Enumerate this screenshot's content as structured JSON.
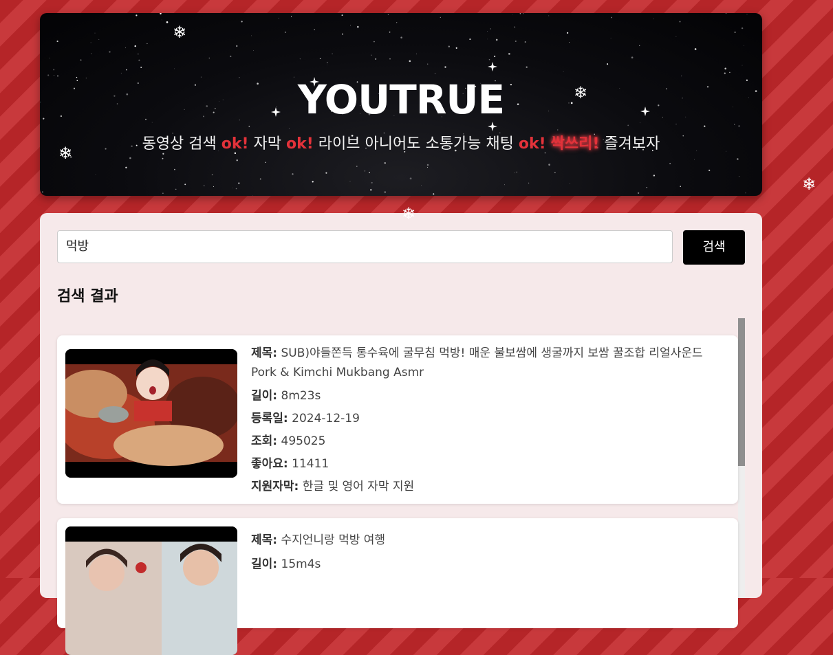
{
  "header": {
    "title": "YOUTRUE",
    "subtitle": {
      "p1": "동영상 검색 ",
      "ok1": "ok!",
      "p2": " 자막 ",
      "ok2": "ok!",
      "p3": " 라이브 아니어도 소통가능 채팅 ",
      "ok3": "ok!",
      "p4": " ",
      "glow": "싹쓰리!",
      "p5": " 즐겨보자"
    }
  },
  "search": {
    "value": "먹방",
    "button_label": "검색"
  },
  "results": {
    "title": "검색 결과",
    "labels": {
      "title": "제목:",
      "length": "길이:",
      "date": "등록일:",
      "views": "조회:",
      "likes": "좋아요:",
      "subtitles": "지원자막:"
    },
    "items": [
      {
        "title": "SUB)야들쫀득 통수육에 굴무침 먹방! 매운 불보쌈에 생굴까지 보쌈 꿀조합 리얼사운드 Pork & Kimchi Mukbang Asmr",
        "length": "8m23s",
        "date": "2024-12-19",
        "views": "495025",
        "likes": "11411",
        "subtitles": "한글 및 영어 자막 지원"
      },
      {
        "title": "수지언니랑 먹방 여행",
        "length": "15m4s"
      }
    ]
  },
  "colors": {
    "accent": "#e3323a",
    "background_stripe_dark": "#b52528",
    "background_stripe_light": "#c8393c",
    "panel": "#f6e9ea",
    "button": "#000000"
  },
  "icons": {
    "decor": "snowflake-icon"
  }
}
